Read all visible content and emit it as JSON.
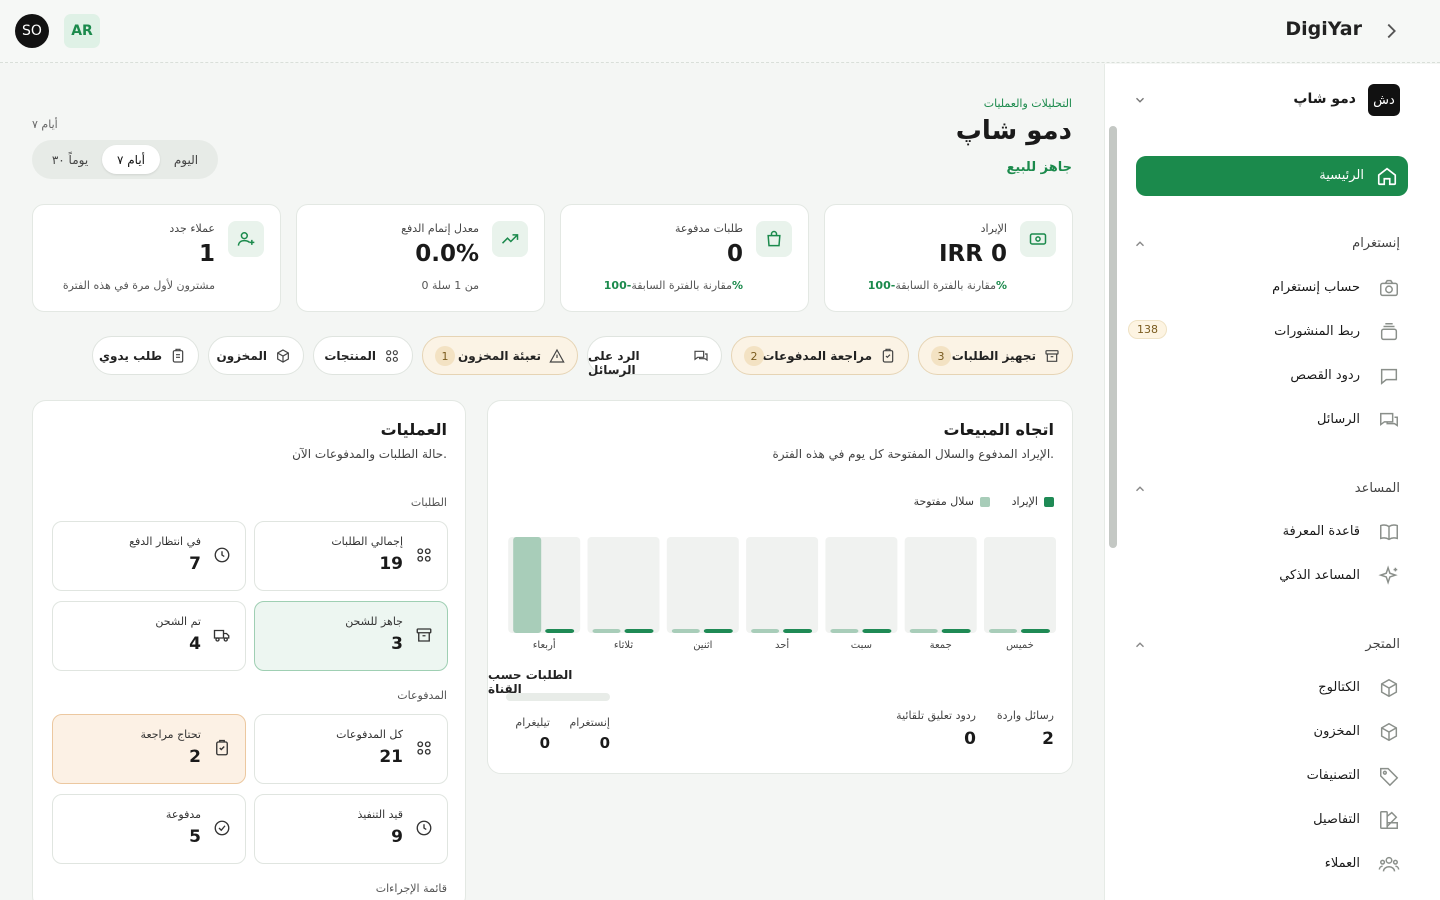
{
  "topbar": {
    "brand": "DigiYar",
    "avatar_user": "SO",
    "avatar_lang": "AR"
  },
  "sidebar": {
    "store_initials": "دش",
    "store_name": "دمو شاپ",
    "home_label": "الرئیسیة",
    "sections": [
      {
        "title": "إنستغرام",
        "items": [
          {
            "label": "حساب إنستغرام",
            "icon": "camera-icon"
          },
          {
            "label": "ربط المنشورات",
            "icon": "layers-icon",
            "badge": "138"
          },
          {
            "label": "ردود القصص",
            "icon": "chat-icon"
          },
          {
            "label": "الرسائل",
            "icon": "messages-icon"
          }
        ]
      },
      {
        "title": "المساعد",
        "items": [
          {
            "label": "قاعدة المعرفة",
            "icon": "book-icon"
          },
          {
            "label": "المساعد الذكي",
            "icon": "sparkle-icon"
          }
        ]
      },
      {
        "title": "المتجر",
        "items": [
          {
            "label": "الكتالوج",
            "icon": "box-icon"
          },
          {
            "label": "المخزون",
            "icon": "box-icon"
          },
          {
            "label": "التصنيفات",
            "icon": "tag-icon"
          },
          {
            "label": "التفاصيل",
            "icon": "palette-icon"
          },
          {
            "label": "العملاء",
            "icon": "users-icon"
          }
        ]
      }
    ]
  },
  "header": {
    "breadcrumb": "التحليلات والعمليات",
    "title": "دمو شاپ",
    "status": "جاهز للبيع",
    "range_label": "۷ أيام",
    "range_options": [
      "اليوم",
      "۷ أيام",
      "۳۰ يوماً"
    ],
    "range_selected": "۷ أيام"
  },
  "kpis": [
    {
      "label": "الإيراد",
      "value": "IRR 0",
      "delta": "-100%",
      "sub": "مقارنة بالفترة السابقة",
      "icon": "cash-icon"
    },
    {
      "label": "طلبات مدفوعة",
      "value": "0",
      "delta": "-100%",
      "sub": "مقارنة بالفترة السابقة",
      "icon": "bag-icon"
    },
    {
      "label": "معدل إتمام الدفع",
      "value": "0.0%",
      "delta": "",
      "sub": "0 من 1 سلة",
      "icon": "trend-up-icon"
    },
    {
      "label": "عملاء جدد",
      "value": "1",
      "delta": "",
      "sub": "مشترون لأول مرة في هذه الفترة",
      "icon": "user-plus-icon"
    }
  ],
  "quick_actions": [
    {
      "label": "تجهيز الطلبات",
      "count": "3",
      "icon": "archive-icon",
      "warn": true
    },
    {
      "label": "مراجعة المدفوعات",
      "count": "2",
      "icon": "clipboard-icon",
      "warn": true
    },
    {
      "label": "الرد على الرسائل",
      "count": "",
      "icon": "messages-icon",
      "warn": false
    },
    {
      "label": "تعبئة المخزون",
      "count": "1",
      "icon": "warning-icon",
      "warn": true
    },
    {
      "label": "المنتجات",
      "count": "",
      "icon": "grid-icon",
      "warn": false
    },
    {
      "label": "المخزون",
      "count": "",
      "icon": "box-icon",
      "warn": false
    },
    {
      "label": "طلب يدوي",
      "count": "",
      "icon": "clipboard-icon",
      "warn": false
    }
  ],
  "sales": {
    "title": "اتجاه المبيعات",
    "subtitle": "الإيراد المدفوع والسلال المفتوحة كل يوم في هذه الفترة.",
    "channel_title": "الطلبات حسب القناة",
    "stats": [
      {
        "label": "رسائل واردة",
        "value": "2"
      },
      {
        "label": "ردود تعليق تلقائية",
        "value": "0"
      },
      {
        "label": "إنستغرام",
        "value": "0"
      },
      {
        "label": "تيليغرام",
        "value": "0"
      }
    ]
  },
  "chart_data": {
    "type": "bar",
    "categories": [
      "خميس",
      "جمعة",
      "سبت",
      "أحد",
      "اثنين",
      "ثلاثاء",
      "أربعاء"
    ],
    "series": [
      {
        "name": "الإيراد",
        "values": [
          0,
          0,
          0,
          0,
          0,
          0,
          0
        ],
        "color": "#1f8a55"
      },
      {
        "name": "سلال مفتوحة",
        "values": [
          0,
          0,
          0,
          0,
          0,
          0,
          1
        ],
        "color": "#a8cdb9"
      }
    ],
    "ylim": [
      0,
      1
    ],
    "legend": "top-right",
    "grid": false
  },
  "operations": {
    "title": "العمليات",
    "subtitle": "حالة الطلبات والمدفوعات الآن.",
    "orders_group": "الطلبات",
    "payments_group": "المدفوعات",
    "actions_group": "قائمة الإجراءات",
    "orders": [
      {
        "label": "إجمالي الطلبات",
        "value": "19",
        "icon": "grid-icon",
        "style": ""
      },
      {
        "label": "في انتظار الدفع",
        "value": "7",
        "icon": "clock-icon",
        "style": ""
      },
      {
        "label": "جاهز للشحن",
        "value": "3",
        "icon": "archive-icon",
        "style": "green"
      },
      {
        "label": "تم الشحن",
        "value": "4",
        "icon": "truck-icon",
        "style": ""
      }
    ],
    "payments": [
      {
        "label": "كل المدفوعات",
        "value": "21",
        "icon": "grid-icon",
        "style": ""
      },
      {
        "label": "تحتاج مراجعة",
        "value": "2",
        "icon": "clipboard-icon",
        "style": "orange"
      },
      {
        "label": "قيد التنفيذ",
        "value": "9",
        "icon": "clock-icon",
        "style": ""
      },
      {
        "label": "مدفوعة",
        "value": "5",
        "icon": "check-circle-icon",
        "style": ""
      }
    ]
  }
}
